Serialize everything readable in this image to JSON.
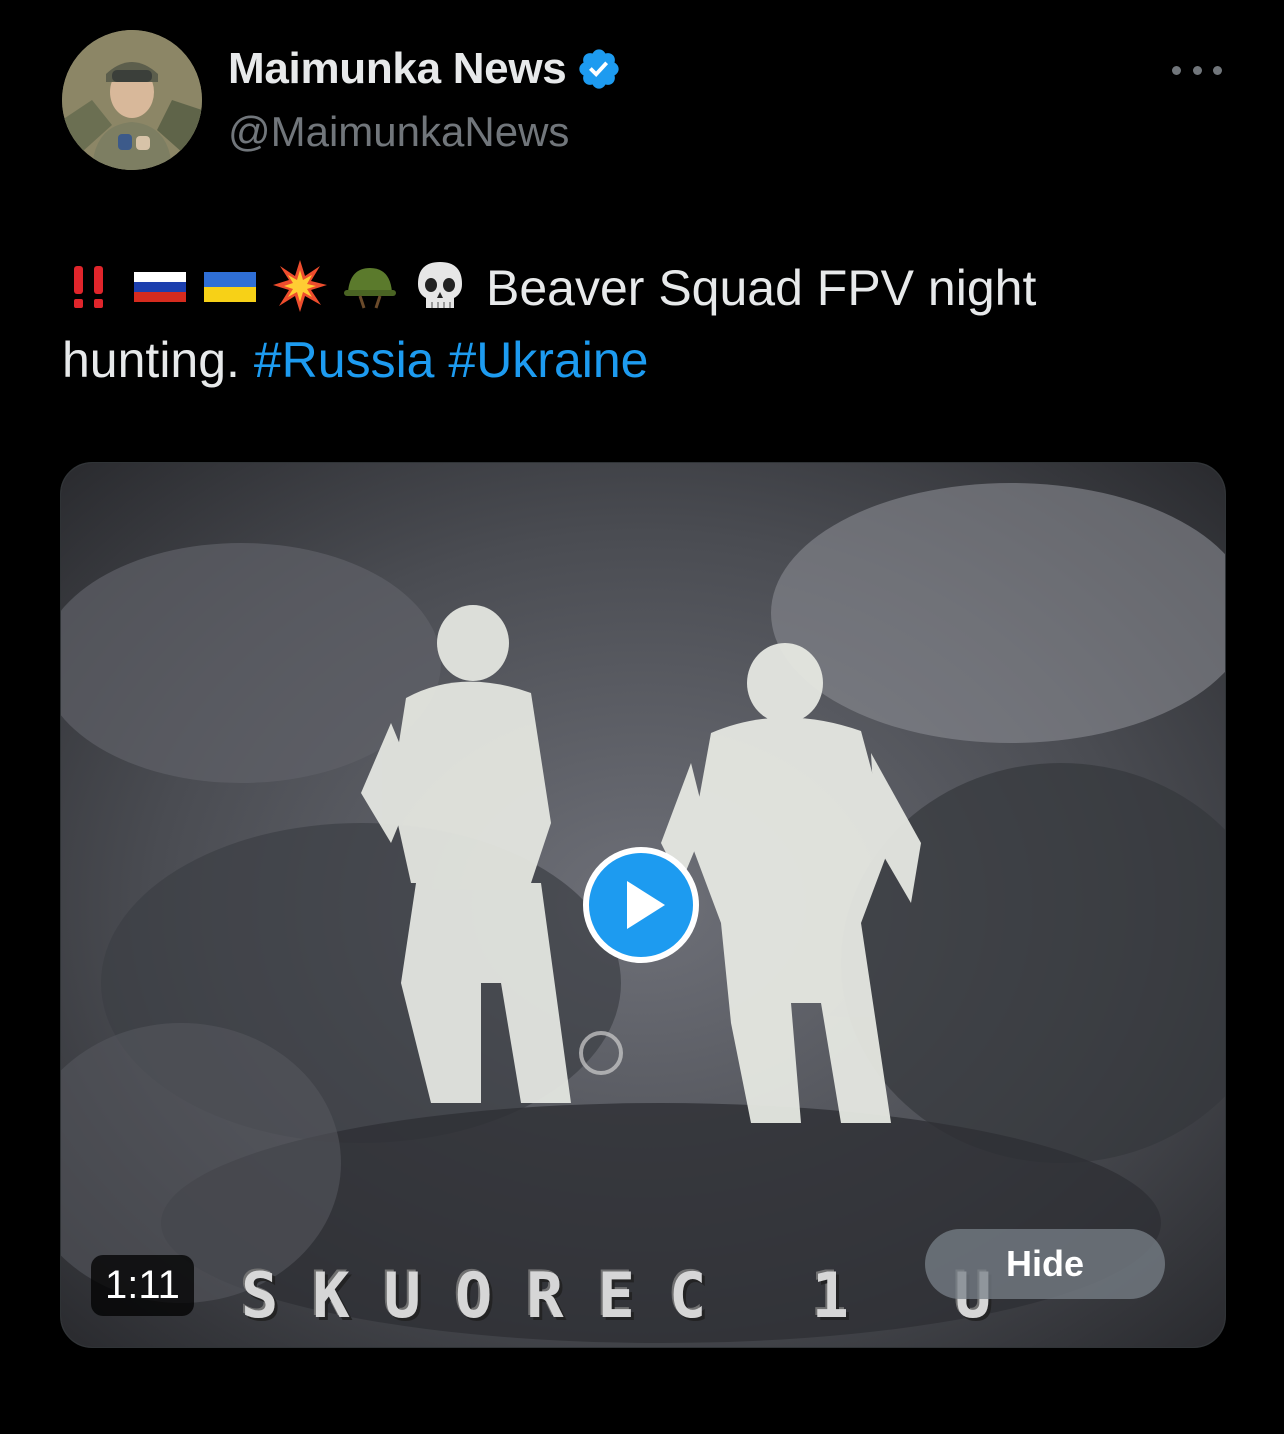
{
  "author": {
    "display_name": "Maimunka News",
    "handle": "@MaimunkaNews",
    "verified": true
  },
  "tweet": {
    "emojis": [
      "double-exclamation-icon",
      "russia-flag-icon",
      "ukraine-flag-icon",
      "collision-icon",
      "military-helmet-icon",
      "skull-icon"
    ],
    "text": "Beaver Squad FPV night hunting.",
    "hashtags": [
      "#Russia",
      "#Ukraine"
    ]
  },
  "media": {
    "duration": "1:11",
    "hide_label": "Hide",
    "watermark": "SKUOREC 1 U"
  },
  "colors": {
    "background": "#000000",
    "text": "#e7e9ea",
    "secondary": "#71767b",
    "accent": "#1d9bf0"
  }
}
